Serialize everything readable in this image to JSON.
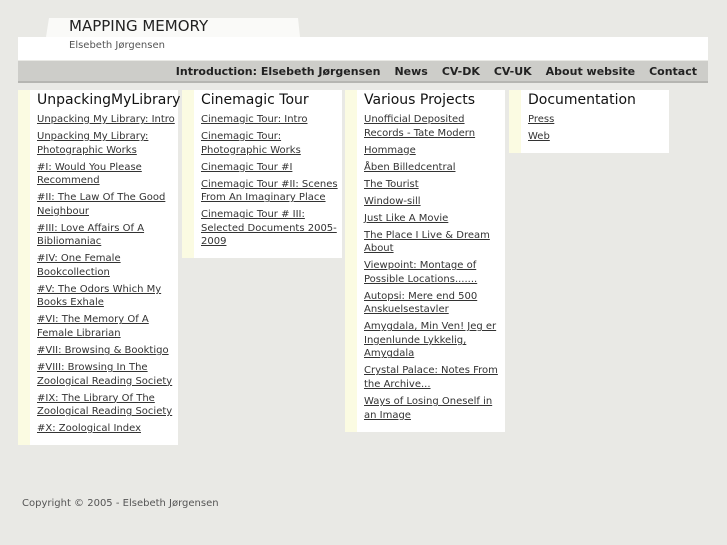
{
  "header": {
    "title": "MAPPING MEMORY",
    "subtitle": "Elsebeth Jørgensen"
  },
  "nav": [
    "Introduction: Elsebeth Jørgensen",
    "News",
    "CV-DK",
    "CV-UK",
    "About website",
    "Contact"
  ],
  "columns": [
    {
      "title": "UnpackingMyLibrary",
      "links": [
        "Unpacking My Library: Intro",
        "Unpacking My Library: Photographic Works",
        "#I: Would You Please Recommend",
        "#II: The Law Of The Good Neighbour",
        "#III: Love Affairs Of A Bibliomaniac",
        "#IV: One Female Bookcollection",
        "#V: The Odors Which My Books Exhale",
        "#VI: The Memory Of A Female Librarian",
        "#VII: Browsing & Booktigo",
        "#VIII: Browsing In The Zoological Reading Society",
        "#IX: The Library Of The Zoological Reading Society",
        "#X: Zoological Index"
      ]
    },
    {
      "title": "Cinemagic Tour",
      "links": [
        "Cinemagic Tour: Intro",
        "Cinemagic Tour: Photographic Works",
        "Cinemagic Tour #I",
        "Cinemagic Tour #II: Scenes From An Imaginary Place",
        "Cinemagic Tour # III: Selected Documents 2005-2009"
      ]
    },
    {
      "title": "Various Projects",
      "links": [
        "Unofficial Deposited Records - Tate Modern",
        "Hommage",
        "Åben Billedcentral",
        "The Tourist",
        "Window-sill",
        "Just Like A Movie",
        "The Place I Live & Dream About",
        "Viewpoint: Montage of Possible Locations.......",
        "Autopsi: Mere end 500 Anskuelsestavler",
        "Amygdala, Min Ven! Jeg er Ingenlunde Lykkelig, Amygdala",
        "Crystal Palace: Notes From the Archive...",
        "Ways of Losing Oneself in an Image"
      ]
    },
    {
      "title": "Documentation",
      "links": [
        "Press",
        "Web"
      ]
    }
  ],
  "footer": "Copyright © 2005 - Elsebeth Jørgensen"
}
